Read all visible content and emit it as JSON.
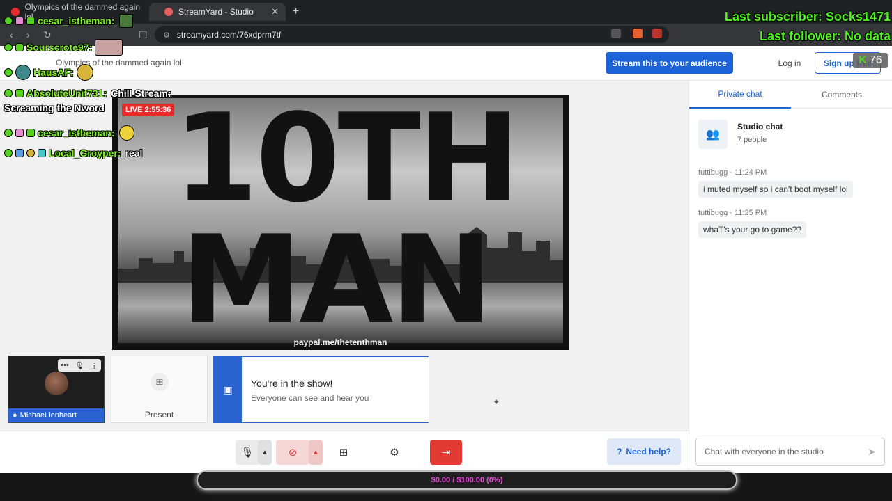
{
  "browser": {
    "tabs": [
      {
        "title": "Olympics of the dammed again lol"
      },
      {
        "title": "StreamYard - Studio"
      }
    ],
    "url": "streamyard.com/76xdprm7tf",
    "new_tab_icon": "plus-icon"
  },
  "header": {
    "page_title": "Olympics of the dammed again lol",
    "stream_button": "Stream this to your audience",
    "login": "Log in",
    "signup": "Sign up free"
  },
  "stage": {
    "live_badge": "LIVE 2:55:36",
    "banner_line1": "10TH",
    "banner_line2": "MAN",
    "paypal": "paypal.me/thetenthman"
  },
  "participants": {
    "camera_name": "MichaeLionheart",
    "present_label": "Present",
    "in_show_title": "You're in the show!",
    "in_show_subtitle": "Everyone can see and hear you"
  },
  "controls": {
    "help": "Need help?",
    "icons": [
      "microphone-icon",
      "chevron-up-icon",
      "camera-off-icon",
      "chevron-up-icon",
      "screen-share-icon",
      "settings-icon",
      "leave-icon"
    ]
  },
  "chat": {
    "tabs": {
      "private": "Private chat",
      "comments": "Comments"
    },
    "studio_chat": {
      "name": "Studio chat",
      "people": "7 people"
    },
    "messages": [
      {
        "user": "tuttibugg",
        "time": "11:24 PM",
        "text": "i muted myself so i can't boot myself lol"
      },
      {
        "user": "tuttibugg",
        "time": "11:25 PM",
        "text": "whaT's your go to game??"
      }
    ],
    "input_placeholder": "Chat with everyone in the studio"
  },
  "goal": {
    "text": "$0.00 / $100.00 (0%)",
    "progress": 0.0
  },
  "overlay": {
    "chat_lines": [
      {
        "user": "cesar_istheman:",
        "message": ""
      },
      {
        "user": "Sourscrote97:",
        "message": ""
      },
      {
        "user": "HausAF:",
        "message": ""
      },
      {
        "user": "AbsoluteUnit731:",
        "message": "Chill Stream:"
      },
      {
        "user": "cesar_istheman:",
        "message": ""
      },
      {
        "user": "Local_Groyper:",
        "message": "real"
      }
    ],
    "continuation": "Screaming the Nword",
    "last_subscriber": "Last subscriber: Socks1471",
    "last_follower": "Last follower: No data",
    "viewer_count": "76"
  },
  "colors": {
    "accent": "#1b63d6",
    "live": "#e52b2b",
    "overlay_green": "#7bf01c",
    "goal_pink": "#e64ad8"
  }
}
